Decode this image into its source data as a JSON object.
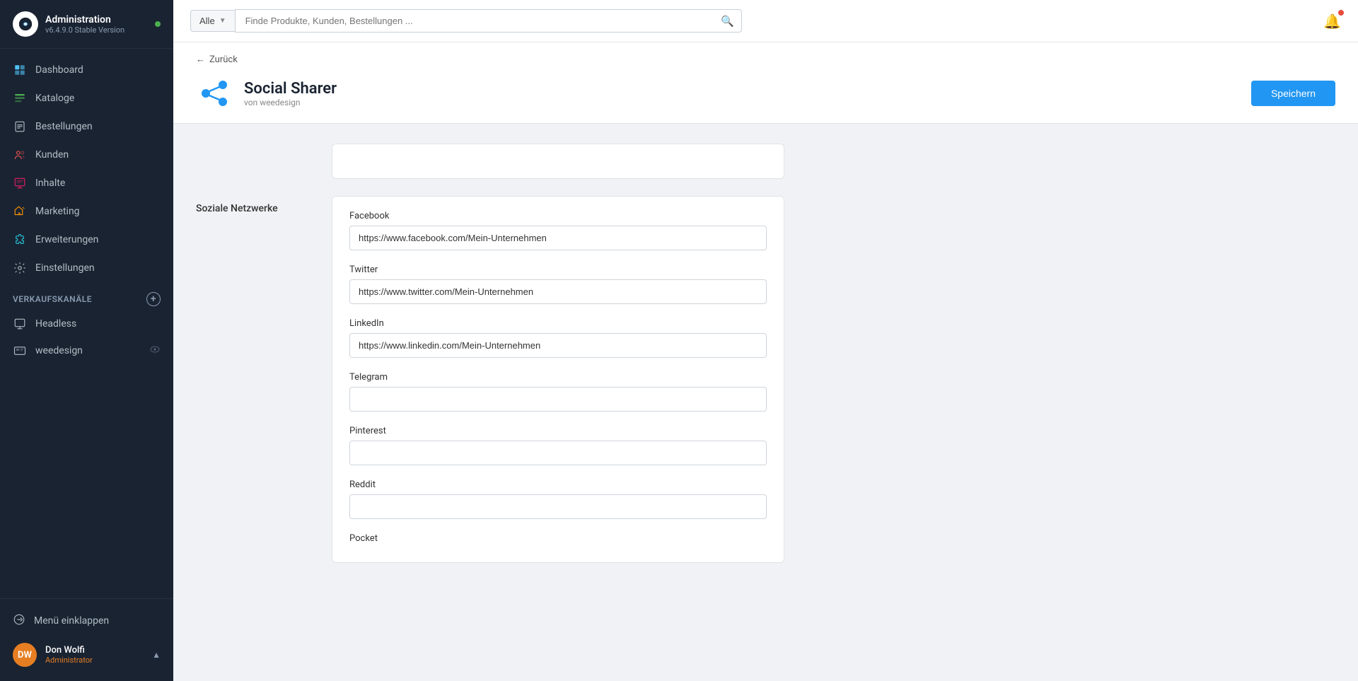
{
  "sidebar": {
    "brand": {
      "name": "Administration",
      "version": "v6.4.9.0 Stable Version"
    },
    "nav_items": [
      {
        "id": "dashboard",
        "label": "Dashboard",
        "icon": "dashboard"
      },
      {
        "id": "kataloge",
        "label": "Kataloge",
        "icon": "catalog"
      },
      {
        "id": "bestellungen",
        "label": "Bestellungen",
        "icon": "orders"
      },
      {
        "id": "kunden",
        "label": "Kunden",
        "icon": "customers"
      },
      {
        "id": "inhalte",
        "label": "Inhalte",
        "icon": "content"
      },
      {
        "id": "marketing",
        "label": "Marketing",
        "icon": "marketing"
      },
      {
        "id": "erweiterungen",
        "label": "Erweiterungen",
        "icon": "extensions"
      },
      {
        "id": "einstellungen",
        "label": "Einstellungen",
        "icon": "settings"
      }
    ],
    "verkaufskanaele_label": "Verkaufskanäle",
    "channels": [
      {
        "id": "headless",
        "label": "Headless",
        "icon": "headless"
      },
      {
        "id": "weedesign",
        "label": "weedesign",
        "icon": "weedesign",
        "has_eye": true
      }
    ],
    "collapse_label": "Menü einklappen",
    "user": {
      "initials": "DW",
      "name": "Don Wolfi",
      "role": "Administrator"
    }
  },
  "topbar": {
    "search_filter": "Alle",
    "search_placeholder": "Finde Produkte, Kunden, Bestellungen ..."
  },
  "header": {
    "back_label": "Zurück",
    "plugin_name": "Social Sharer",
    "plugin_author": "von weedesign",
    "save_label": "Speichern"
  },
  "form": {
    "section_label": "Soziale Netzwerke",
    "fields": [
      {
        "id": "facebook",
        "label": "Facebook",
        "value": "https://www.facebook.com/Mein-Unternehmen",
        "placeholder": ""
      },
      {
        "id": "twitter",
        "label": "Twitter",
        "value": "https://www.twitter.com/Mein-Unternehmen",
        "placeholder": ""
      },
      {
        "id": "linkedin",
        "label": "LinkedIn",
        "value": "https://www.linkedin.com/Mein-Unternehmen",
        "placeholder": ""
      },
      {
        "id": "telegram",
        "label": "Telegram",
        "value": "",
        "placeholder": ""
      },
      {
        "id": "pinterest",
        "label": "Pinterest",
        "value": "",
        "placeholder": ""
      },
      {
        "id": "reddit",
        "label": "Reddit",
        "value": "",
        "placeholder": ""
      },
      {
        "id": "pocket",
        "label": "Pocket",
        "value": "",
        "placeholder": ""
      }
    ]
  }
}
